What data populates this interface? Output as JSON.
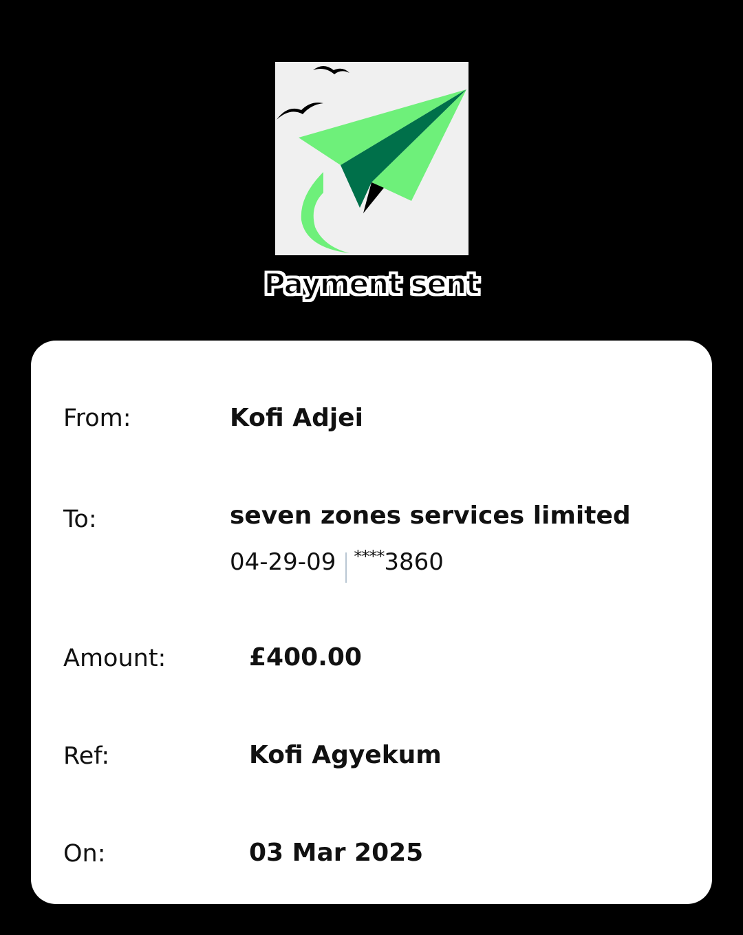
{
  "header": {
    "logo_icon": "paper-plane-icon",
    "title": "Payment sent"
  },
  "details": {
    "from": {
      "label": "From:",
      "value": "Kofi Adjei"
    },
    "to": {
      "label": "To:",
      "value": "seven zones services limited",
      "sort_code": "04-29-09",
      "account_mask": "****",
      "account_last4": "3860"
    },
    "amount": {
      "label": "Amount:",
      "value": "£400.00"
    },
    "ref": {
      "label": "Ref:",
      "value": "Kofi Agyekum"
    },
    "on": {
      "label": "On:",
      "value": "03 Mar 2025"
    }
  },
  "colors": {
    "background": "#000000",
    "card": "#ffffff",
    "plane_light": "#6ef07a",
    "plane_dark": "#00704a",
    "logo_bg": "#f0f0f0"
  }
}
